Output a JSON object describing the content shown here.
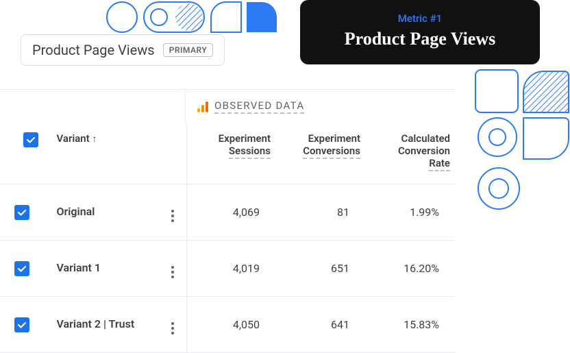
{
  "overlay": {
    "subtitle": "Metric #1",
    "title": "Product Page Views"
  },
  "metric": {
    "name": "Product Page Views",
    "badge": "PRIMARY"
  },
  "table": {
    "observed_label": "OBSERVED DATA",
    "headers": {
      "variant": "Variant",
      "sort_arrow": "↑",
      "sessions_l1": "Experiment",
      "sessions_l2": "Sessions",
      "conversions_l1": "Experiment",
      "conversions_l2": "Conversions",
      "rate_l1": "Calculated",
      "rate_l2": "Conversion",
      "rate_l3": "Rate"
    },
    "rows": [
      {
        "name": "Original",
        "sessions": "4,069",
        "conversions": "81",
        "rate": "1.99%"
      },
      {
        "name": "Variant 1",
        "sessions": "4,019",
        "conversions": "651",
        "rate": "16.20%"
      },
      {
        "name": "Variant 2 | Trust",
        "sessions": "4,050",
        "conversions": "641",
        "rate": "15.83%"
      }
    ]
  }
}
